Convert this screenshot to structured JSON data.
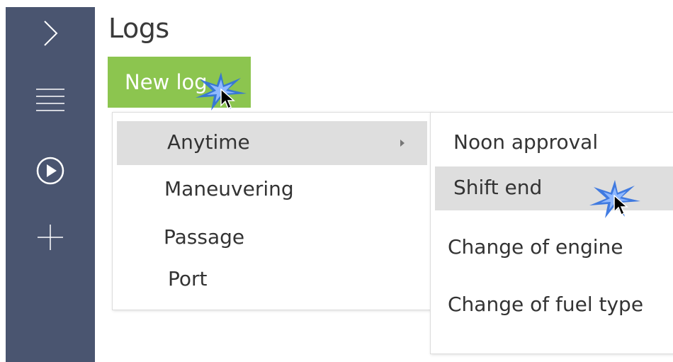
{
  "page": {
    "title": "Logs"
  },
  "toolbar": {
    "new_log_label": "New log"
  },
  "sidebar": {
    "items": [
      {
        "icon": "chevron-right-icon"
      },
      {
        "icon": "menu-lines-icon"
      },
      {
        "icon": "play-circle-icon"
      },
      {
        "icon": "plus-icon"
      }
    ]
  },
  "menu": {
    "items": [
      {
        "label": "Anytime",
        "has_submenu": true,
        "highlighted": true
      },
      {
        "label": "Maneuvering"
      },
      {
        "label": "Passage"
      },
      {
        "label": "Port"
      }
    ]
  },
  "submenu": {
    "items": [
      {
        "label": "Noon approval"
      },
      {
        "label": "Shift end",
        "highlighted": true
      },
      {
        "label": "Change of engine"
      },
      {
        "label": "Change of fuel type"
      }
    ]
  },
  "colors": {
    "sidebar": "#4a5570",
    "new_log_button": "#8cc54f",
    "highlight": "#dedede",
    "click_effect": "#2f6fe0"
  }
}
